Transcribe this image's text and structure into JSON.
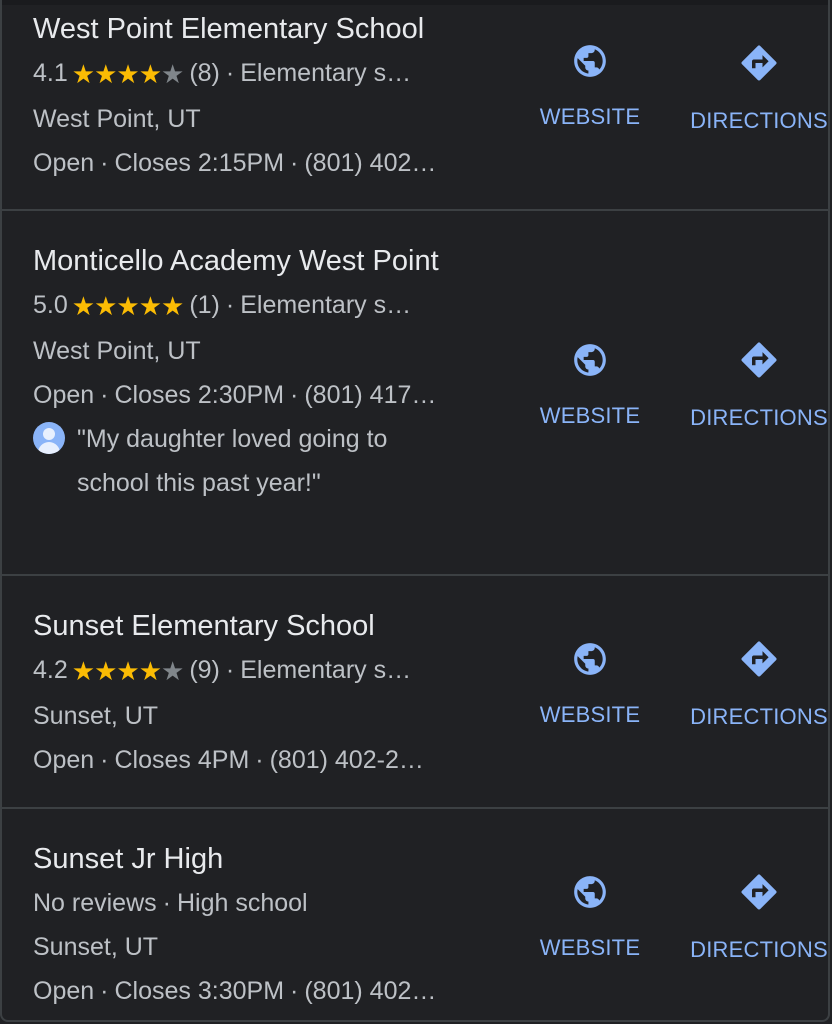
{
  "results": [
    {
      "name": "West Point Elementary School",
      "rating": "4.1",
      "stars_filled": 4,
      "review_count": "(8)",
      "category": "Elementary s…",
      "location": "West Point, UT",
      "status": "Open",
      "hours": "Closes 2:15PM",
      "phone": "(801) 402…",
      "website_label": "WEBSITE",
      "directions_label": "DIRECTIONS"
    },
    {
      "name": "Monticello Academy West Point",
      "rating": "5.0",
      "stars_filled": 5,
      "review_count": "(1)",
      "category": "Elementary s…",
      "location": "West Point, UT",
      "status": "Open",
      "hours": "Closes 2:30PM",
      "phone": "(801) 417…",
      "review_snippet": "\"My daughter loved going to school this past year!\"",
      "website_label": "WEBSITE",
      "directions_label": "DIRECTIONS"
    },
    {
      "name": "Sunset Elementary School",
      "rating": "4.2",
      "stars_filled": 4,
      "review_count": "(9)",
      "category": "Elementary s…",
      "location": "Sunset, UT",
      "status": "Open",
      "hours": "Closes 4PM",
      "phone": "(801) 402-2…",
      "website_label": "WEBSITE",
      "directions_label": "DIRECTIONS"
    },
    {
      "name": "Sunset Jr High",
      "no_reviews": "No reviews",
      "category": "High school",
      "location": "Sunset, UT",
      "status": "Open",
      "hours": "Closes 3:30PM",
      "phone": "(801) 402…",
      "website_label": "WEBSITE",
      "directions_label": "DIRECTIONS"
    }
  ],
  "separator": "·",
  "colors": {
    "background": "#202124",
    "accent": "#8ab4f8",
    "star": "#fbbc04",
    "star_empty": "#80868b",
    "text_primary": "#e8eaed",
    "text_secondary": "#bdc1c6"
  },
  "icons": {
    "website": "globe-icon",
    "directions": "directions-icon",
    "star": "star-icon",
    "avatar": "avatar-icon"
  }
}
